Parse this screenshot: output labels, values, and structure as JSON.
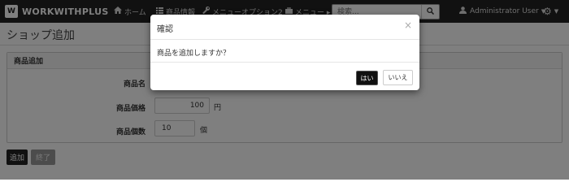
{
  "navbar": {
    "logo_glyph": "W",
    "brand": "WORKWITHPLUS",
    "items": [
      {
        "label": "ホーム",
        "icon": "home-icon"
      },
      {
        "label": "商品情報",
        "icon": "list-icon"
      },
      {
        "label": "メニューオプション2",
        "icon": "wrench-icon"
      },
      {
        "label": "メニュー ▸",
        "icon": "briefcase-icon"
      }
    ],
    "search": {
      "placeholder": "検索..."
    },
    "user": "Administrator User",
    "settings_icon": "gear-icon"
  },
  "page": {
    "title": "ショップ追加"
  },
  "panel": {
    "heading": "商品追加",
    "fields": [
      {
        "label": "商品名",
        "value": ""
      },
      {
        "label": "商品価格",
        "value": "100",
        "unit": "円"
      },
      {
        "label": "商品個数",
        "value": "10",
        "unit": "個"
      }
    ]
  },
  "actions": {
    "add": "追加",
    "end": "終了"
  },
  "modal": {
    "title": "確認",
    "close": "×",
    "message": "商品を追加しますか？",
    "yes": "はい",
    "no": "いいえ"
  }
}
